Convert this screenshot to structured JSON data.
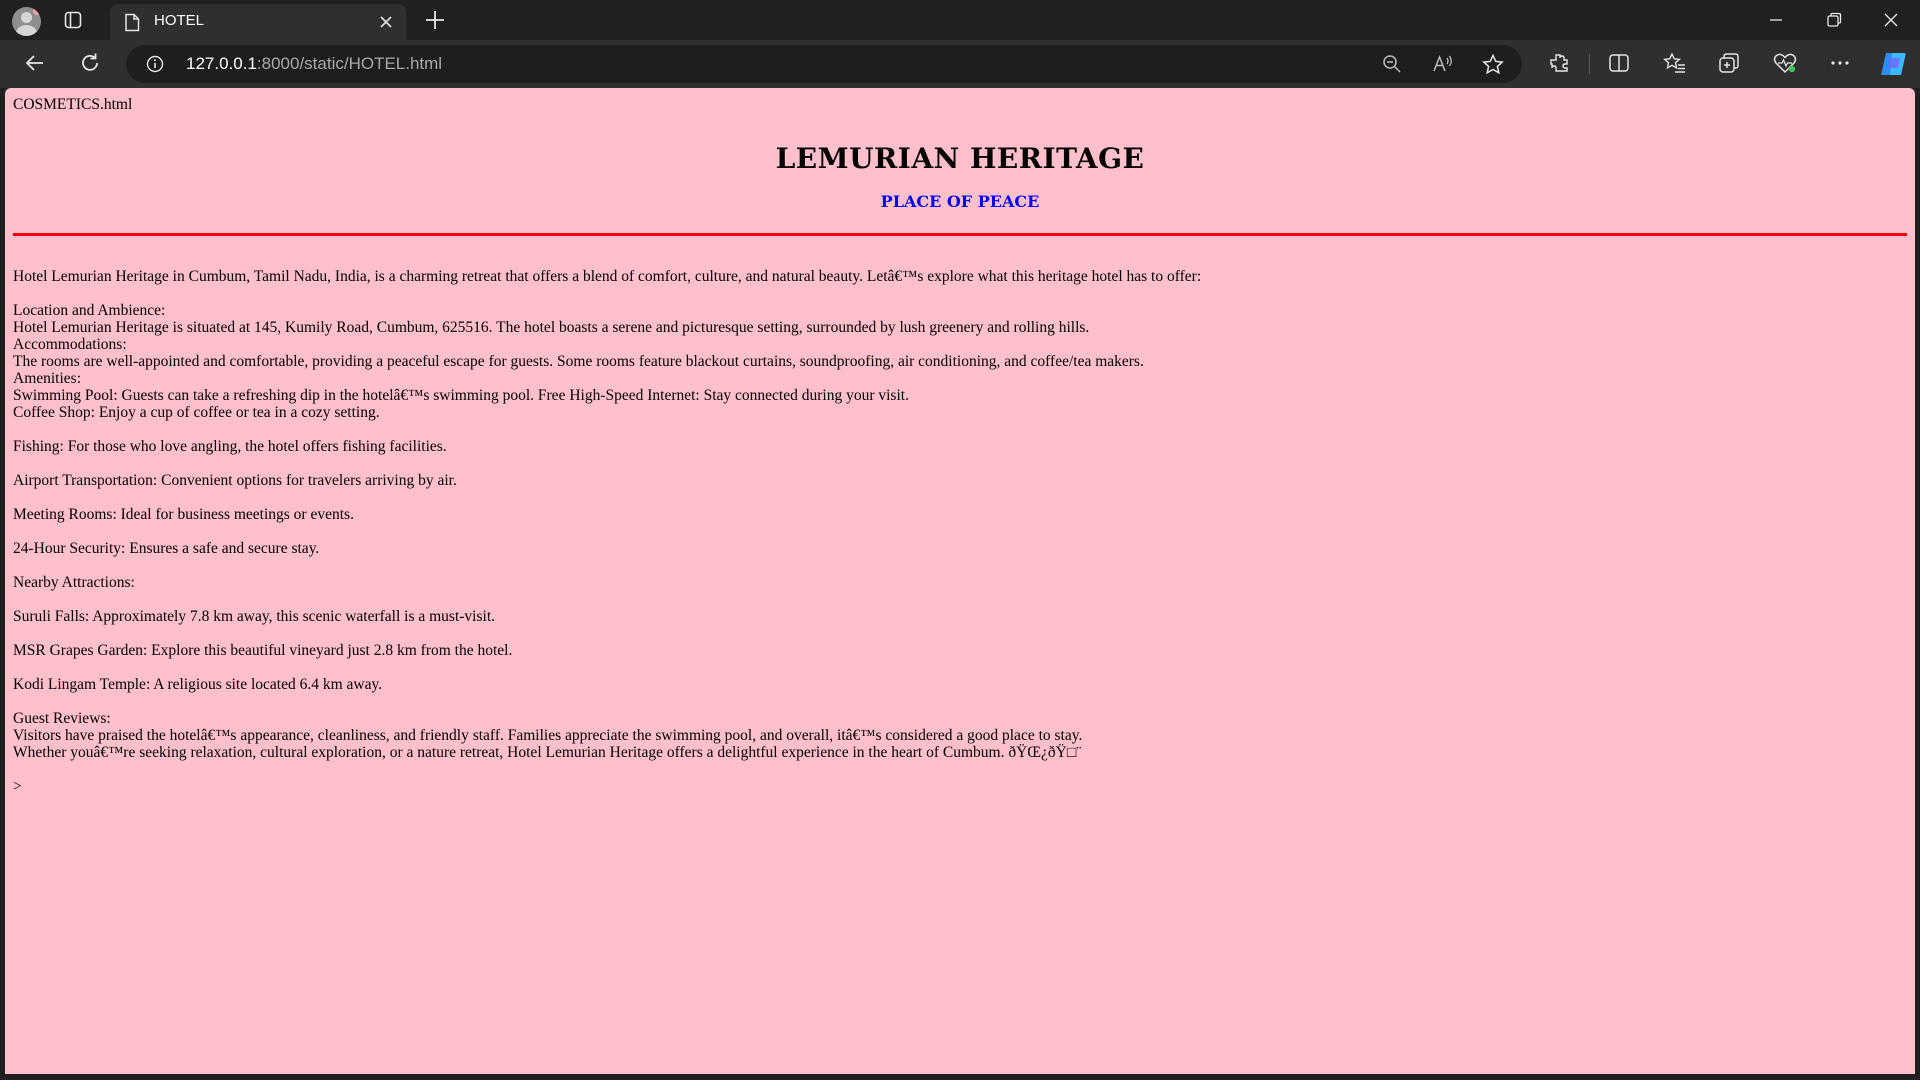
{
  "browser": {
    "tab_title": "HOTEL",
    "url_host": "127.0.0.1",
    "url_rest": ":8000/static/HOTEL.html"
  },
  "page": {
    "link": "COSMETICS.html",
    "heading": "LEMURIAN HERITAGE",
    "subheading": "PLACE OF PEACE",
    "intro": "Hotel Lemurian Heritage in Cumbum, Tamil Nadu, India, is a charming retreat that offers a blend of comfort, culture, and natural beauty. Letâ€™s explore what this heritage hotel has to offer:",
    "location_title": "Location and Ambience:",
    "location_text": "Hotel Lemurian Heritage is situated at 145, Kumily Road, Cumbum, 625516. The hotel boasts a serene and picturesque setting, surrounded by lush greenery and rolling hills.",
    "accommodations_title": "Accommodations:",
    "accommodations_text": "The rooms are well-appointed and comfortable, providing a peaceful escape for guests. Some rooms feature blackout curtains, soundproofing, air conditioning, and coffee/tea makers.",
    "amenities_title": "Amenities:",
    "amenity_pool": "Swimming Pool: Guests can take a refreshing dip in the hotelâ€™s swimming pool. Free High-Speed Internet: Stay connected during your visit.",
    "amenity_coffee": "Coffee Shop: Enjoy a cup of coffee or tea in a cozy setting.",
    "amenity_fishing": "Fishing: For those who love angling, the hotel offers fishing facilities.",
    "amenity_airport": "Airport Transportation: Convenient options for travelers arriving by air.",
    "amenity_meeting": "Meeting Rooms: Ideal for business meetings or events.",
    "amenity_security": "24-Hour Security: Ensures a safe and secure stay.",
    "nearby_title": "Nearby Attractions:",
    "nearby_suruli": "Suruli Falls: Approximately 7.8 km away, this scenic waterfall is a must-visit.",
    "nearby_msr": "MSR Grapes Garden: Explore this beautiful vineyard just 2.8 km from the hotel.",
    "nearby_kodi": "Kodi Lingam Temple: A religious site located 6.4 km away.",
    "reviews_title": "Guest Reviews:",
    "reviews_text": "Visitors have praised the hotelâ€™s appearance, cleanliness, and friendly staff. Families appreciate the swimming pool, and overall, itâ€™s considered a good place to stay.",
    "closing_text": "Whether youâ€™re seeking relaxation, cultural exploration, or a nature retreat, Hotel Lemurian Heritage offers a delightful experience in the heart of Cumbum. ðŸŒ¿ðŸ□¨",
    "stray": ">"
  },
  "colors": {
    "page_bg": "#ffc0cb",
    "subheading": "#0000ff",
    "rule": "#ee0000"
  },
  "icons": [
    "profile-icon",
    "workspaces-icon",
    "document-icon",
    "close-icon",
    "new-tab-icon",
    "minimize-icon",
    "restore-icon",
    "window-close-icon",
    "back-icon",
    "refresh-icon",
    "info-icon",
    "zoom-out-icon",
    "read-aloud-icon",
    "favorite-star-icon",
    "extensions-icon",
    "split-screen-icon",
    "favorites-icon",
    "collections-icon",
    "browser-essentials-icon",
    "more-icon",
    "copilot-icon"
  ]
}
